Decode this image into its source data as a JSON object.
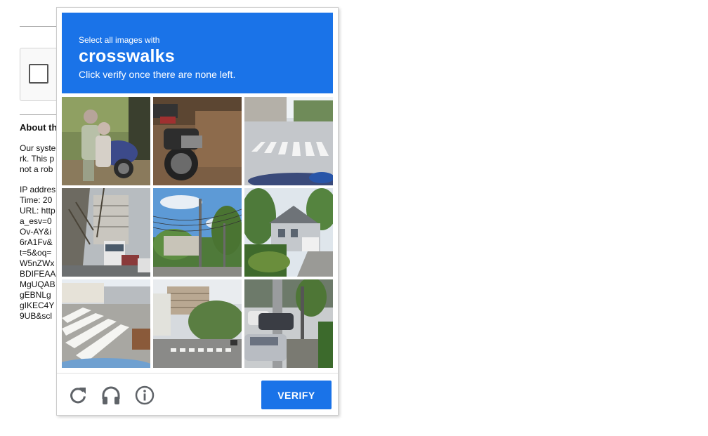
{
  "background_page": {
    "about_title": "About th",
    "lines": [
      "Our syste",
      "rk. This p",
      "not a rob",
      "",
      "IP addres",
      "Time: 20",
      "URL: http",
      "a_esv=0",
      "Ov-AY&i",
      "6rA1Fv&",
      "t=5&oq=",
      "W5nZWx",
      "BDIFEAA",
      "MgUQAB",
      "gEBNLg",
      "gIKEC4Y",
      "9UB&scl"
    ]
  },
  "challenge": {
    "header": {
      "instruction": "Select all images with",
      "target": "crosswalks",
      "subtext": "Click verify once there are none left."
    },
    "tiles": [
      {
        "name": "tile-motorcycle-riders",
        "scene": "motorcycle"
      },
      {
        "name": "tile-motorcycle-dirt",
        "scene": "motorcycle2"
      },
      {
        "name": "tile-crosswalk-street",
        "scene": "crosswalk-street"
      },
      {
        "name": "tile-trees-building-bus",
        "scene": "bus-trees"
      },
      {
        "name": "tile-trees-powerlines",
        "scene": "powerlines"
      },
      {
        "name": "tile-house",
        "scene": "house"
      },
      {
        "name": "tile-crosswalk-corner",
        "scene": "crosswalk-corner"
      },
      {
        "name": "tile-crosswalk-road",
        "scene": "crosswalk-road"
      },
      {
        "name": "tile-parked-cars",
        "scene": "parked-cars"
      }
    ],
    "footer": {
      "reload_icon": "reload-icon",
      "audio_icon": "headphones-icon",
      "info_icon": "info-icon",
      "verify_label": "VERIFY"
    }
  },
  "colors": {
    "accent": "#1a73e8"
  }
}
